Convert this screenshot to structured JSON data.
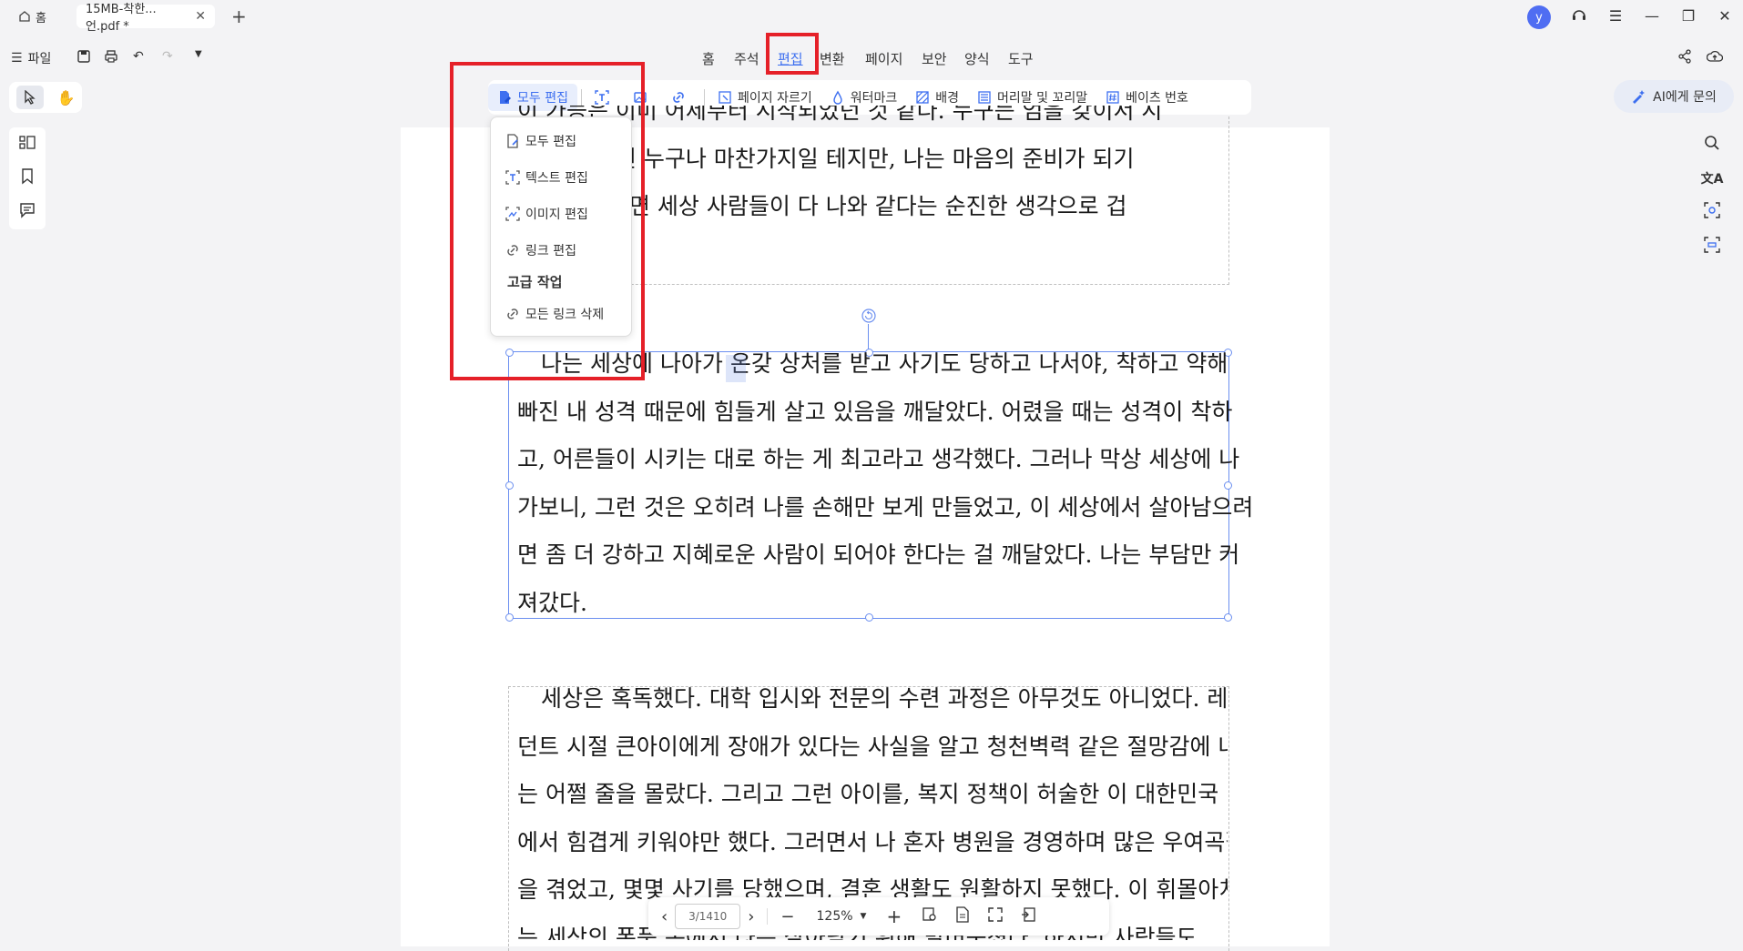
{
  "titlebar": {
    "home_tab": "홈",
    "doc_tab": "15MB-착한...언.pdf *",
    "avatar_letter": "y"
  },
  "toolbar": {
    "file_label": "파일"
  },
  "menu": {
    "items": [
      "홈",
      "주석",
      "편집",
      "변환",
      "페이지",
      "보안",
      "양식",
      "도구"
    ],
    "active": "편집"
  },
  "ribbon": {
    "edit_all": "모두 편집",
    "crop_page": "페이지 자르기",
    "watermark": "워터마크",
    "background": "배경",
    "header_footer": "머리말 및 꼬리말",
    "bates": "베이츠 번호"
  },
  "ai_button": "AI에게 문의",
  "dropdown": {
    "items": [
      "모두 편집",
      "텍스트 편집",
      "이미지 편집",
      "링크 편집"
    ],
    "section_header": "고급 작업",
    "remove_links": "모든 링크 삭제"
  },
  "document": {
    "block1_lines": [
      "이 가능은 이미 어제부터 시작되었던 것 같다. 누구든 엄을 갖이서 시",
      "에 나서는 건 누구나 마찬가지일 테지만, 나는 마음의 준비가 되기",
      "금 생각해보면 세상 사람들이 다 나와 같다는 순진한 생각으로 겁",
      "던 것 같다."
    ],
    "block2_lines": [
      "나는 세상에 나아가 온갖 상처를 받고 사기도 당하고 나서야, 착하고 약해",
      "빠진 내 성격 때문에 힘들게 살고 있음을 깨달았다. 어렸을 때는 성격이 착하",
      "고, 어른들이 시키는 대로 하는 게 최고라고 생각했다. 그러나 막상 세상에 나",
      "가보니, 그런 것은 오히려 나를 손해만 보게 만들었고, 이 세상에서 살아남으려",
      "면 좀 더 강하고 지혜로운 사람이 되어야 한다는 걸 깨달았다. 나는 부담만 커",
      "져갔다."
    ],
    "block3_lines": [
      "세상은 혹독했다. 대학 입시와 전문의 수련 과정은 아무것도 아니었다. 레지",
      "던트 시절 큰아이에게 장애가 있다는 사실을 알고 청천벽력 같은 절망감에 나",
      "는 어쩔 줄을 몰랐다. 그리고 그런 아이를, 복지 정책이 허술한 이 대한민국 땅",
      "에서 힘겹게 키워야만 했다. 그러면서 나 혼자 병원을 경영하며 많은 우여곡절",
      "을 겪었고, 몇몇 사기를 당했으며, 결혼 생활도 원활하지 못했다. 이 휘몰아치",
      "는 세상의 폭풍 속에서 나는 살아남기 위해 발버둥쳤다. 하지만 사람들도"
    ]
  },
  "bottom": {
    "page_indicator": "3/1410",
    "zoom": "125%"
  },
  "colors": {
    "accent": "#3d6ff0",
    "highlight_box": "#e52028"
  }
}
